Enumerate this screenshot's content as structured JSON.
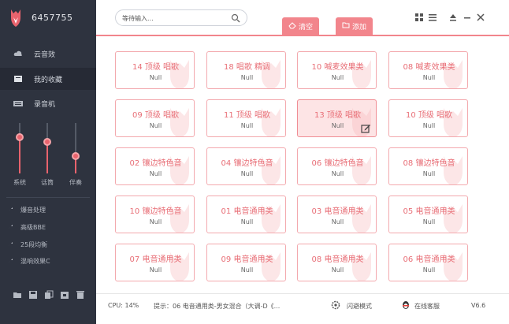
{
  "sidebar": {
    "user_id": "6457755",
    "nav": [
      {
        "label": "云音效",
        "icon": "cloud-icon"
      },
      {
        "label": "我的收藏",
        "icon": "folder-icon"
      },
      {
        "label": "录音机",
        "icon": "keyboard-icon"
      }
    ],
    "mixer": [
      {
        "label": "系统",
        "level": 0.72
      },
      {
        "label": "话筒",
        "level": 0.62
      },
      {
        "label": "伴奏",
        "level": 0.35
      }
    ],
    "effects": [
      {
        "label": "爆音处理"
      },
      {
        "label": "高级BBE"
      },
      {
        "label": "25段均衡"
      },
      {
        "label": "混响效果C"
      }
    ],
    "tools": [
      "folder-open-icon",
      "save-icon",
      "copy-icon",
      "duplicate-icon",
      "trash-icon"
    ]
  },
  "toolbar": {
    "search_placeholder": "等待输入...",
    "tab_clear": "清空",
    "tab_add": "添加"
  },
  "grid": {
    "cards": [
      {
        "name": "14 顶级 唱歌",
        "value": "Null"
      },
      {
        "name": "18 唱歌 精调",
        "value": "Null"
      },
      {
        "name": "10 喊麦效果类",
        "value": "Null"
      },
      {
        "name": "08 喊麦效果类",
        "value": "Null"
      },
      {
        "name": "09 顶级 唱歌",
        "value": "Null"
      },
      {
        "name": "11 顶级 唱歌",
        "value": "Null"
      },
      {
        "name": "13 顶级 唱歌",
        "value": "Null",
        "selected": true
      },
      {
        "name": "10 顶级 唱歌",
        "value": "Null"
      },
      {
        "name": "02 镶边特色音",
        "value": "Null"
      },
      {
        "name": "04 镶边特色音",
        "value": "Null"
      },
      {
        "name": "06 镶边特色音",
        "value": "Null"
      },
      {
        "name": "08 镶边特色音",
        "value": "Null"
      },
      {
        "name": "10 镶边特色音",
        "value": "Null"
      },
      {
        "name": "01 电音通用类",
        "value": "Null"
      },
      {
        "name": "03 电音通用类",
        "value": "Null"
      },
      {
        "name": "05 电音通用类",
        "value": "Null"
      },
      {
        "name": "07 电音通用类",
        "value": "Null"
      },
      {
        "name": "09 电音通用类",
        "value": "Null"
      },
      {
        "name": "08 电音通用类",
        "value": "Null"
      },
      {
        "name": "06 电音通用类",
        "value": "Null"
      }
    ]
  },
  "statusbar": {
    "cpu": "CPU: 14%",
    "hint": "提示：06  电音通用类-男女混合（大调-D《...",
    "flash_mode": "闪避模式",
    "online_service": "在线客服",
    "version": "V6.6"
  },
  "colors": {
    "accent": "#f2858c",
    "sidebar_bg": "#2e333f",
    "card_text": "#e86f77"
  }
}
